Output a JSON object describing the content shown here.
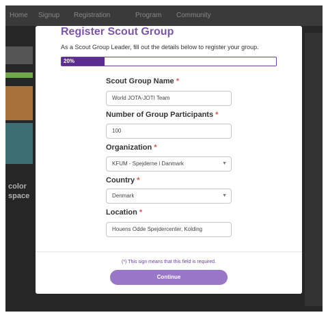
{
  "nav": {
    "items": [
      "Home",
      "Signup",
      "Registration",
      "Program",
      "Community"
    ]
  },
  "background": {
    "side_text": [
      "color",
      "space"
    ]
  },
  "modal": {
    "title": "Register Scout Group",
    "intro": "As a Scout Group Leader, fill out the details below to register your group.",
    "progress": {
      "label": "20%",
      "percent": 20
    },
    "fields": {
      "group_name": {
        "label": "Scout Group Name",
        "required_mark": "*",
        "value": "World JOTA-JOTI Team"
      },
      "participants": {
        "label": "Number of Group Participants",
        "required_mark": "*",
        "value": "100"
      },
      "organization": {
        "label": "Organization",
        "required_mark": "*",
        "value": "KFUM - Spejderne i Danmark"
      },
      "country": {
        "label": "Country",
        "required_mark": "*",
        "value": "Denmark"
      },
      "location": {
        "label": "Location",
        "required_mark": "*",
        "value": "Houens Odde Spejdercenter, Kolding"
      }
    },
    "required_note": "(*) This sign means that this field is required.",
    "continue_label": "Continue"
  },
  "colors": {
    "accent": "#5b2d91",
    "title": "#7a55a8",
    "button": "#9877c6",
    "required": "#d9534f"
  }
}
